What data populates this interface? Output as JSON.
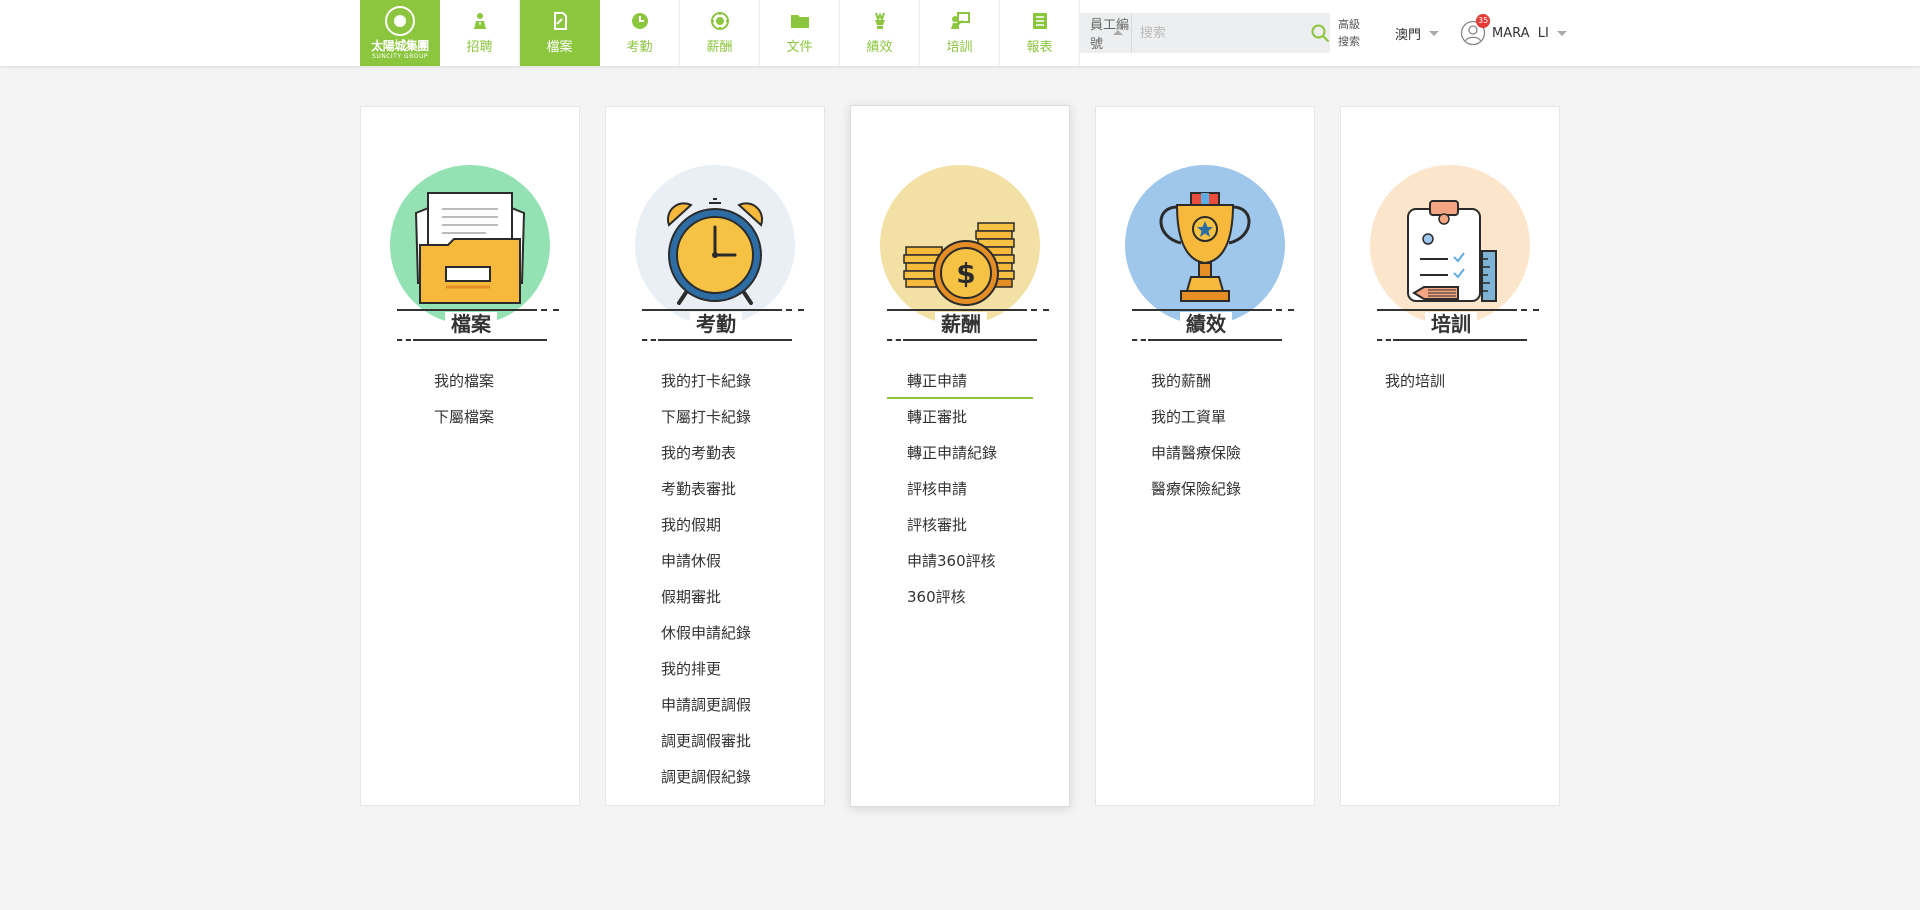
{
  "brand": {
    "name_cn": "太陽城集團",
    "name_en": "SUNCITY GROUP",
    "color": "#8cc63f"
  },
  "nav": [
    {
      "label": "招聘",
      "icon": "recruit-icon"
    },
    {
      "label": "檔案",
      "icon": "file-icon",
      "active": true
    },
    {
      "label": "考勤",
      "icon": "clock-icon"
    },
    {
      "label": "薪酬",
      "icon": "salary-icon"
    },
    {
      "label": "文件",
      "icon": "folder-icon"
    },
    {
      "label": "績效",
      "icon": "trophy-icon"
    },
    {
      "label": "培訓",
      "icon": "training-icon"
    },
    {
      "label": "報表",
      "icon": "report-icon"
    }
  ],
  "search": {
    "scope": "員工編號",
    "placeholder": "搜索",
    "advanced_label_1": "高級",
    "advanced_label_2": "搜索"
  },
  "region": "澳門",
  "user": {
    "name": "MARA  LI",
    "notification_count": "35"
  },
  "cards": [
    {
      "title": "檔案",
      "items": [
        "我的檔案",
        "下屬檔案"
      ]
    },
    {
      "title": "考勤",
      "items": [
        "我的打卡紀錄",
        "下屬打卡紀錄",
        "我的考勤表",
        "考勤表審批",
        "我的假期",
        "申請休假",
        "假期審批",
        "休假申請紀錄",
        "我的排更",
        "申請調更調假",
        "調更調假審批",
        "調更調假紀錄"
      ]
    },
    {
      "title": "薪酬",
      "items": [
        "轉正申請",
        "轉正審批",
        "轉正申請紀錄",
        "評核申請",
        "評核審批",
        "申請360評核",
        "360評核"
      ],
      "active_item": "轉正申請"
    },
    {
      "title": "績效",
      "items": [
        "我的薪酬",
        "我的工資單",
        "申請醫療保險",
        "醫療保險紀錄"
      ]
    },
    {
      "title": "培訓",
      "items": [
        "我的培訓"
      ]
    }
  ]
}
